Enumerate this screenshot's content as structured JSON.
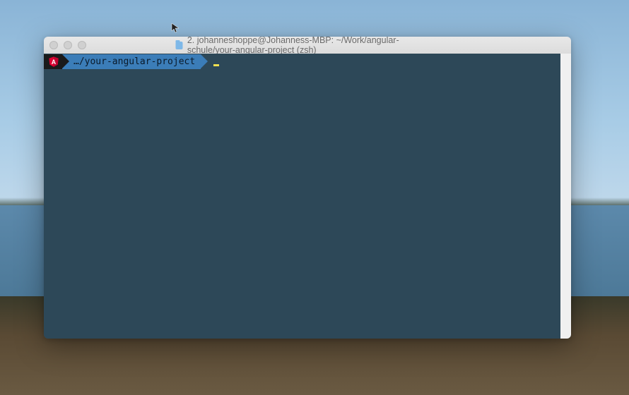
{
  "window": {
    "title": "2. johanneshoppe@Johanness-MBP: ~/Work/angular-schule/your-angular-project (zsh)"
  },
  "prompt": {
    "badge_letter": "A",
    "path": "…/your-angular-project"
  },
  "colors": {
    "terminal_bg": "#2d4858",
    "prompt_blue": "#3b7db8",
    "angular_red": "#dd0031",
    "cursor_yellow": "#f0e050"
  }
}
